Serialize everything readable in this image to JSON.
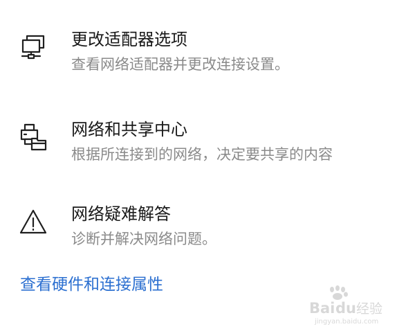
{
  "settings": {
    "adapter": {
      "title": "更改适配器选项",
      "description": "查看网络适配器并更改连接设置。",
      "icon": "network-adapter-icon"
    },
    "sharing_center": {
      "title": "网络和共享中心",
      "description": "根据所连接到的网络，决定要共享的内容",
      "icon": "sharing-center-icon"
    },
    "troubleshooter": {
      "title": "网络疑难解答",
      "description": "诊断并解决网络问题。",
      "icon": "warning-icon"
    }
  },
  "links": {
    "hardware_properties": "查看硬件和连接属性"
  },
  "watermark": {
    "brand": "Baidu经验",
    "url": "jingyan.baidu.com"
  },
  "colors": {
    "title": "#1a1a1a",
    "description": "#8a8a8a",
    "link": "#2b6fd0",
    "background": "#ffffff"
  }
}
